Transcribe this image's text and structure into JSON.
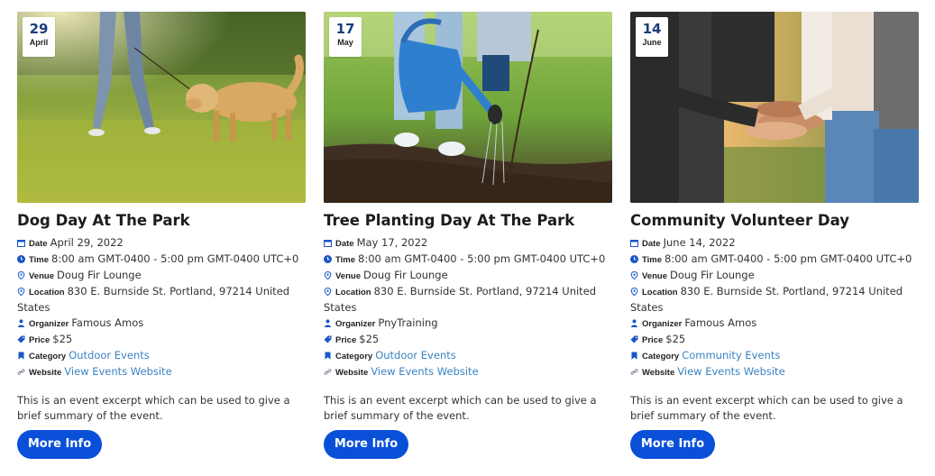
{
  "labels": {
    "date": "Date",
    "time": "Time",
    "venue": "Venue",
    "location": "Location",
    "organizer": "Organizer",
    "price": "Price",
    "category": "Category",
    "website": "Website"
  },
  "colors": {
    "button": "#0a4fd8",
    "link": "#3b82c4",
    "icon": "#1a56c8",
    "badge_day": "#1a3d7c"
  },
  "events": [
    {
      "badge_day": "29",
      "badge_month": "April",
      "image": "dog-walking-in-park",
      "title": "Dog Day At The Park",
      "date": "April 29, 2022",
      "time": "8:00 am GMT-0400 - 5:00 pm GMT-0400 UTC+0",
      "venue": "Doug Fir Lounge",
      "location": "830 E. Burnside St. Portland, 97214 United States",
      "organizer": "Famous Amos",
      "price": "$25",
      "category": "Outdoor Events",
      "website": "View Events Website",
      "excerpt": "This is an event excerpt which can be used to give a brief summary of the event.",
      "button": "More Info"
    },
    {
      "badge_day": "17",
      "badge_month": "May",
      "image": "watering-tree-sapling",
      "title": "Tree Planting Day At The Park",
      "date": "May 17, 2022",
      "time": "8:00 am GMT-0400 - 5:00 pm GMT-0400 UTC+0",
      "venue": "Doug Fir Lounge",
      "location": "830 E. Burnside St. Portland, 97214 United States",
      "organizer": "PnyTraining",
      "price": "$25",
      "category": "Outdoor Events",
      "website": "View Events Website",
      "excerpt": "This is an event excerpt which can be used to give a brief summary of the event.",
      "button": "More Info"
    },
    {
      "badge_day": "14",
      "badge_month": "June",
      "image": "stacked-hands-team",
      "title": "Community Volunteer Day",
      "date": "June 14, 2022",
      "time": "8:00 am GMT-0400 - 5:00 pm GMT-0400 UTC+0",
      "venue": "Doug Fir Lounge",
      "location": "830 E. Burnside St. Portland, 97214 United States",
      "organizer": "Famous Amos",
      "price": "$25",
      "category": "Community Events",
      "website": "View Events Website",
      "excerpt": "This is an event excerpt which can be used to give a brief summary of the event.",
      "button": "More Info"
    }
  ]
}
